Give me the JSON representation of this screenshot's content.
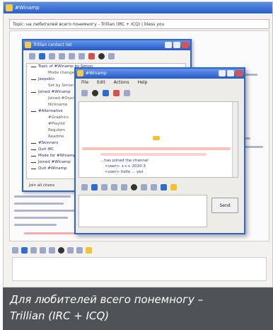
{
  "main_window": {
    "title": "#Winamp",
    "topic": "Topic: на любителей всего понемногу - Trillian (IRC + ICQ) | bless you"
  },
  "contact_window": {
    "title": "Trillian contact list",
    "items": [
      {
        "label": "Topic of #Winamp by Simon",
        "sub": false
      },
      {
        "label": "Mode changed",
        "sub": true
      },
      {
        "label": "Jeepskin",
        "sub": false
      },
      {
        "label": "Set by Simon",
        "sub": true
      },
      {
        "label": "Joined #Winamp",
        "sub": false
      },
      {
        "label": "Joined #Oracle",
        "sub": true
      },
      {
        "label": "Nickname",
        "sub": true
      },
      {
        "label": "#Alternative",
        "sub": false
      },
      {
        "label": "#Graphics",
        "sub": true
      },
      {
        "label": "#Playlist",
        "sub": true
      },
      {
        "label": "Regulars",
        "sub": true
      },
      {
        "label": "Readme",
        "sub": true
      },
      {
        "label": "#Skinners",
        "sub": false
      },
      {
        "label": "Quit IRC",
        "sub": false
      },
      {
        "label": "Mode for #Winamp",
        "sub": false
      },
      {
        "label": "Joined #Winamp",
        "sub": false
      },
      {
        "label": "Quit #Winamp",
        "sub": false
      }
    ],
    "status": "Join all chans"
  },
  "chat_window": {
    "title": "#Winamp",
    "menu": [
      "File",
      "Edit",
      "Actions",
      "Help"
    ],
    "lines": [
      "...has joined the channel",
      "<user> +++ 2020:3",
      "<user> hello ... yes"
    ],
    "send_label": "Send"
  },
  "caption": {
    "line1": "Для любителей всего понемногу –",
    "line2": "Trillian (IRC + ICQ)"
  }
}
